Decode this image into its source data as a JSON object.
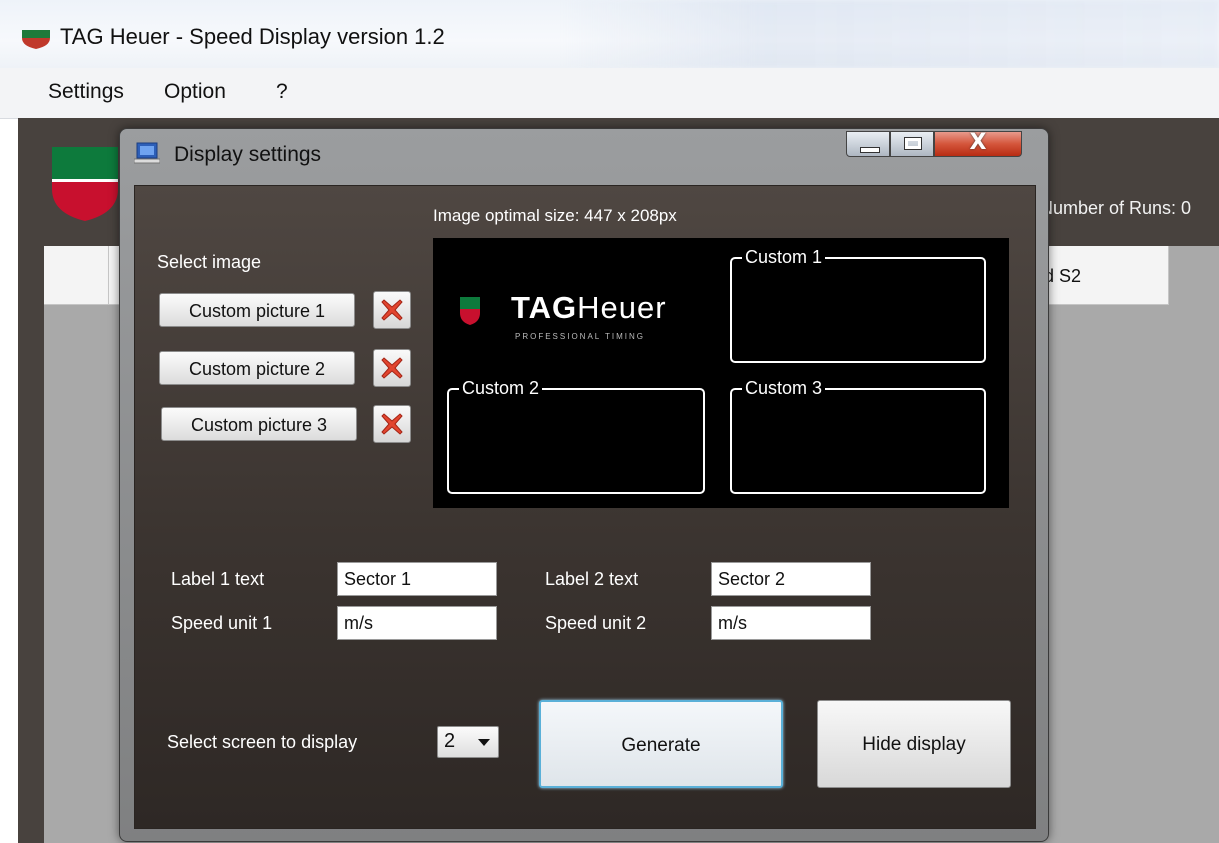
{
  "window": {
    "title": "TAG Heuer - Speed Display version 1.2",
    "menu": [
      "Settings",
      "Option",
      "?"
    ]
  },
  "background": {
    "runs_text": "Number of Runs: 0",
    "column_s2": "ed S2"
  },
  "dialog": {
    "title": "Display settings",
    "close_glyph": "X",
    "optimal_size": "Image optimal size: 447 x 208px",
    "select_image": "Select image",
    "pictures": [
      "Custom picture 1",
      "Custom picture 2",
      "Custom picture 3"
    ],
    "preview": {
      "brand_bold": "TAG",
      "brand_light": "Heuer",
      "brand_sub": "PROFESSIONAL TIMING",
      "zones": [
        "Custom 1",
        "Custom 2",
        "Custom 3"
      ]
    },
    "label1_caption": "Label 1 text",
    "label1_value": "Sector 1",
    "label2_caption": "Label 2 text",
    "label2_value": "Sector 2",
    "unit1_caption": "Speed unit 1",
    "unit1_value": "m/s",
    "unit2_caption": "Speed unit 2",
    "unit2_value": "m/s",
    "screen_caption": "Select screen to display",
    "screen_value": "2",
    "generate": "Generate",
    "hide": "Hide display"
  },
  "colors": {
    "delete_red": "#e2452f",
    "dialog_dark": "#3b3430",
    "accent_focus": "#5ab0d8"
  }
}
